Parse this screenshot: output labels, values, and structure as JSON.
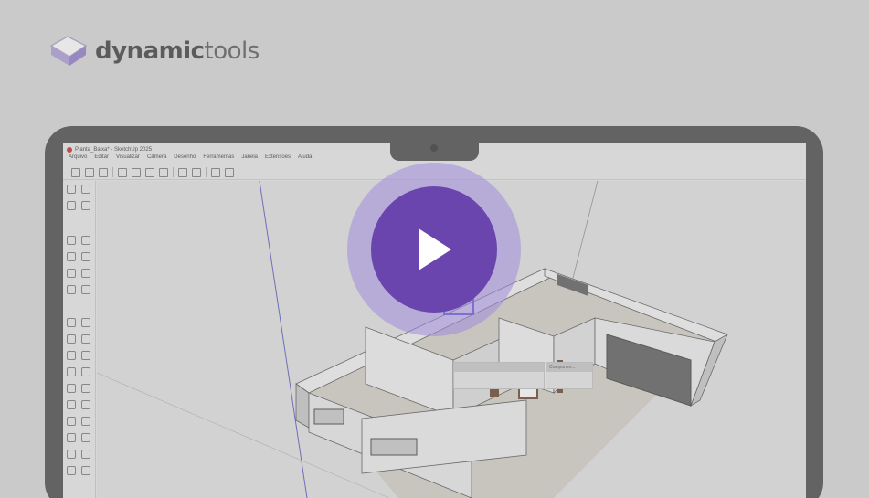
{
  "brand": {
    "name_bold": "dynamic",
    "name_light": "tools"
  },
  "window": {
    "title": "Planta_Baixa* - SketchUp 2025"
  },
  "menu": [
    "Arquivo",
    "Editar",
    "Visualizar",
    "Câmera",
    "Desenho",
    "Ferramentas",
    "Janela",
    "Extensões",
    "Ajuda"
  ],
  "panels": {
    "components_title": "Componen..."
  },
  "colors": {
    "accent": "#6a45ad",
    "halo": "#a08cdc",
    "bezel": "#5e5e5e",
    "background": "#dcdcdc"
  },
  "icons": {
    "play": "play-icon",
    "logo": "dynamictools-logo-icon"
  }
}
